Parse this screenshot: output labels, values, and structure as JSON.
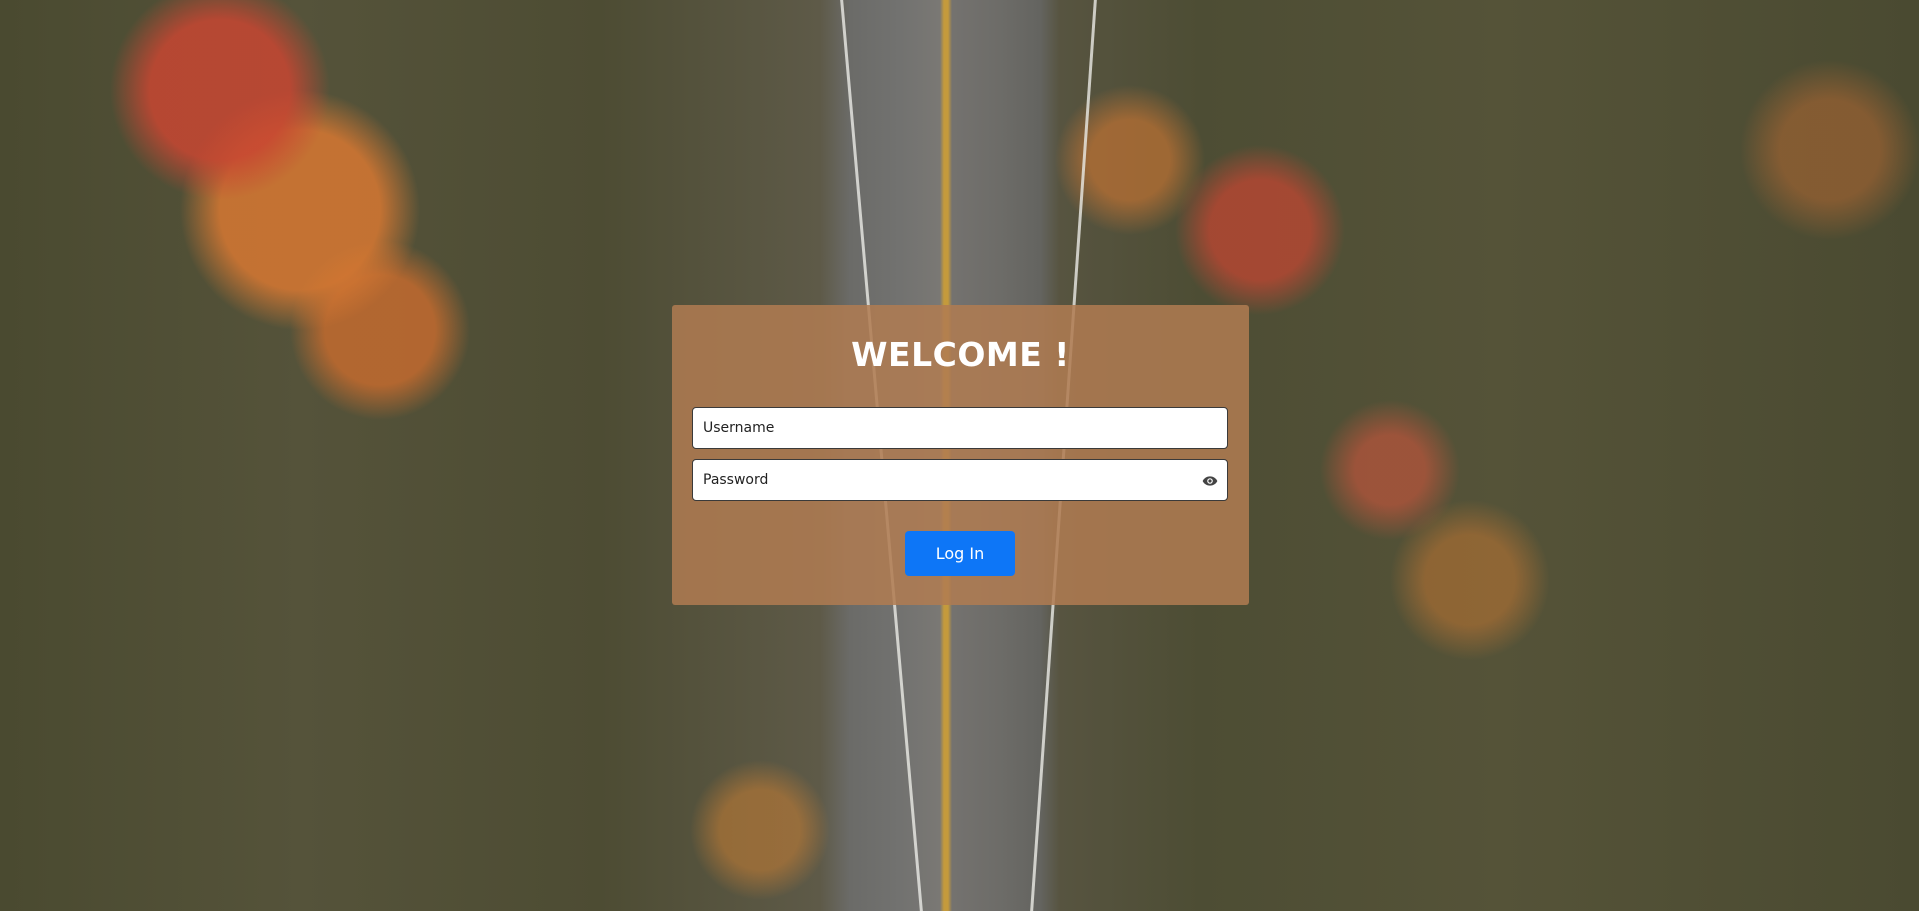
{
  "login": {
    "title": "WELCOME !",
    "username_placeholder": "Username",
    "password_placeholder": "Password",
    "toggle_password_icon": "eye-icon",
    "submit_label": "Log In"
  },
  "colors": {
    "card_background": "#b07c52",
    "button_background": "#0d76f7",
    "title_text": "#ffffff"
  },
  "background": {
    "description_icon": "aerial-forest-road-photo"
  }
}
